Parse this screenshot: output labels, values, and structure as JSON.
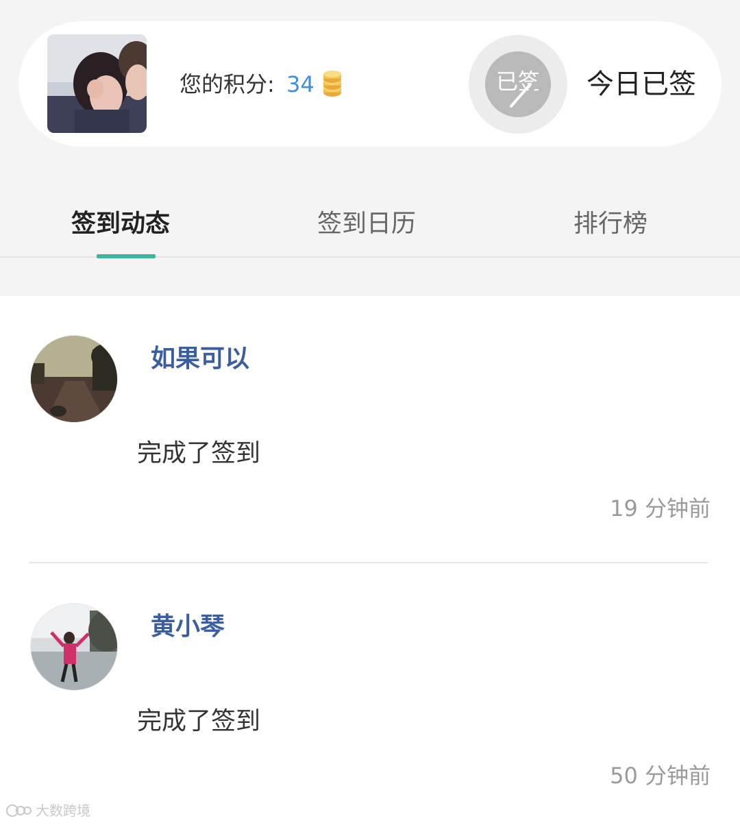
{
  "profile": {
    "avatar_description": "profile-photo",
    "points_label": "您的积分:",
    "points_value": "34",
    "coin_icon": "coin-stack-icon",
    "badge_text": "已签",
    "status_text": "今日已签"
  },
  "tabs": [
    {
      "label": "签到动态",
      "active": true
    },
    {
      "label": "签到日历",
      "active": false
    },
    {
      "label": "排行榜",
      "active": false
    }
  ],
  "feed": [
    {
      "name": "如果可以",
      "message": "完成了签到",
      "time": "19 分钟前"
    },
    {
      "name": "黄小琴",
      "message": "完成了签到",
      "time": "50 分钟前"
    }
  ],
  "watermark": {
    "text": "大数跨境"
  },
  "colors": {
    "accent": "#3bb89a",
    "link_blue": "#3f8fe0",
    "name_blue": "#3a5ea0",
    "coin_gold": "#f2c14e"
  }
}
